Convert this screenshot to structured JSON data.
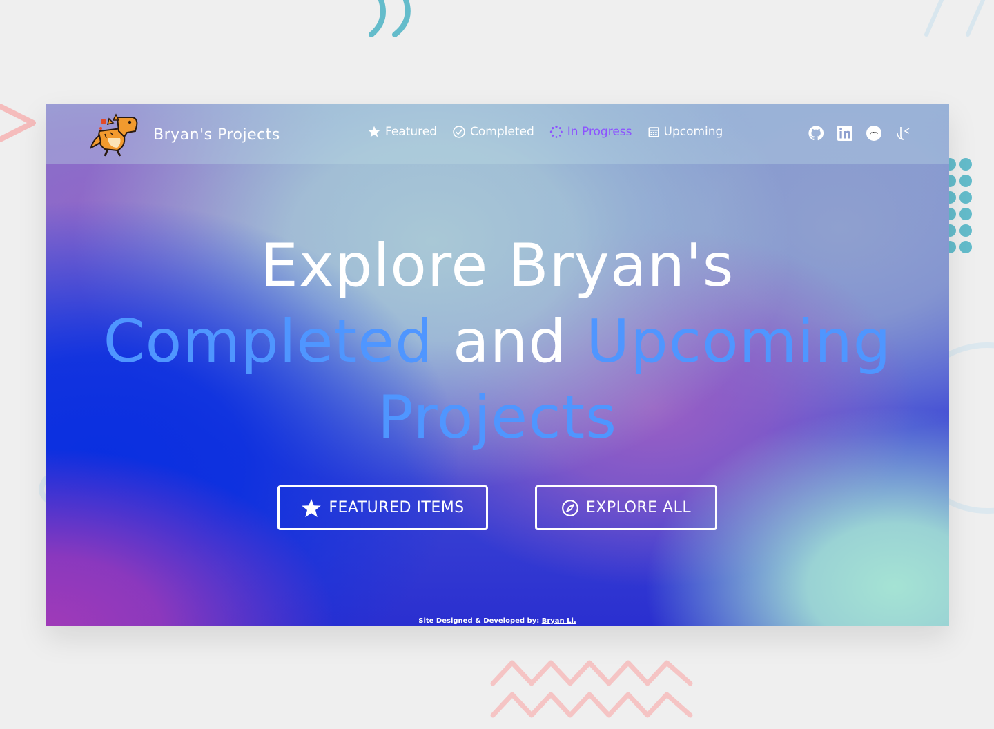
{
  "header": {
    "brand_name": "Bryan's Projects",
    "logo_icon": "dinosaur-logo-icon",
    "nav": [
      {
        "label": "Featured",
        "icon": "star-icon",
        "active": false
      },
      {
        "label": "Completed",
        "icon": "check-circle-icon",
        "active": false
      },
      {
        "label": "In Progress",
        "icon": "spinner-icon",
        "active": true
      },
      {
        "label": "Upcoming",
        "icon": "calendar-icon",
        "active": false
      }
    ],
    "social": [
      "github-icon",
      "linkedin-icon",
      "devpost-icon",
      "kattis-icon"
    ]
  },
  "hero": {
    "line1": "Explore Bryan's",
    "line2_a": "Completed",
    "line2_b": "and",
    "line2_c": "Upcoming",
    "line3": "Projects"
  },
  "buttons": {
    "featured_label": "FEATURED ITEMS",
    "explore_label": "EXPLORE ALL"
  },
  "footer": {
    "prefix": "Site Designed & Developed by:",
    "author": "Bryan Li."
  },
  "colors": {
    "accent_blue": "#4f96ff",
    "active_nav": "#8c52ff",
    "page_bg": "#efefef"
  }
}
